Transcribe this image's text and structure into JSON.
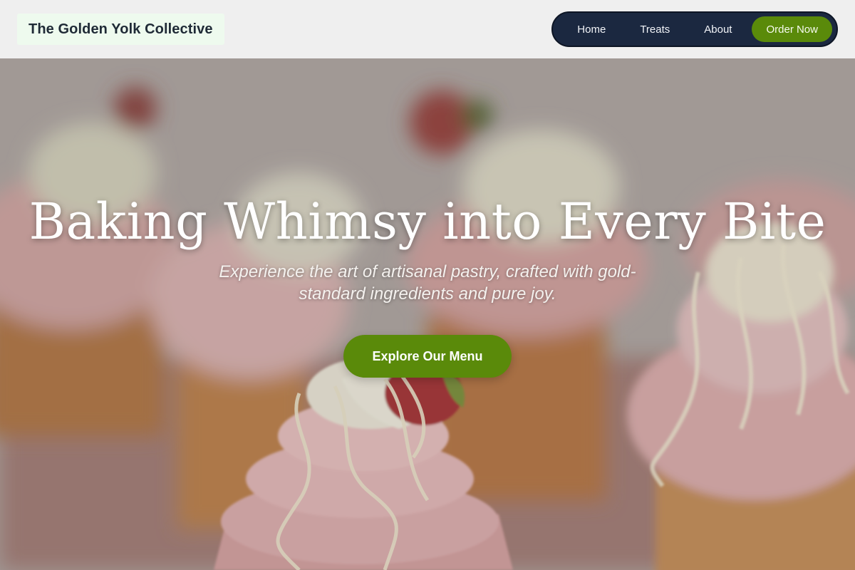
{
  "brand": {
    "name": "The Golden Yolk Collective"
  },
  "nav": {
    "links": [
      "Home",
      "Treats",
      "About"
    ],
    "cta": "Order Now"
  },
  "hero": {
    "title": "Baking Whimsy into Every Bite",
    "subtitle": "Experience the art of artisanal pastry, crafted with gold-standard ingredients and pure joy.",
    "button": "Explore Our Menu",
    "image": "cupcakes-with-pink-frosting-and-strawberries"
  },
  "colors": {
    "accent": "#5a8a0a",
    "nav_bg": "#1b2840",
    "brand_bg": "#eefaee",
    "brand_text": "#1f2a36"
  }
}
